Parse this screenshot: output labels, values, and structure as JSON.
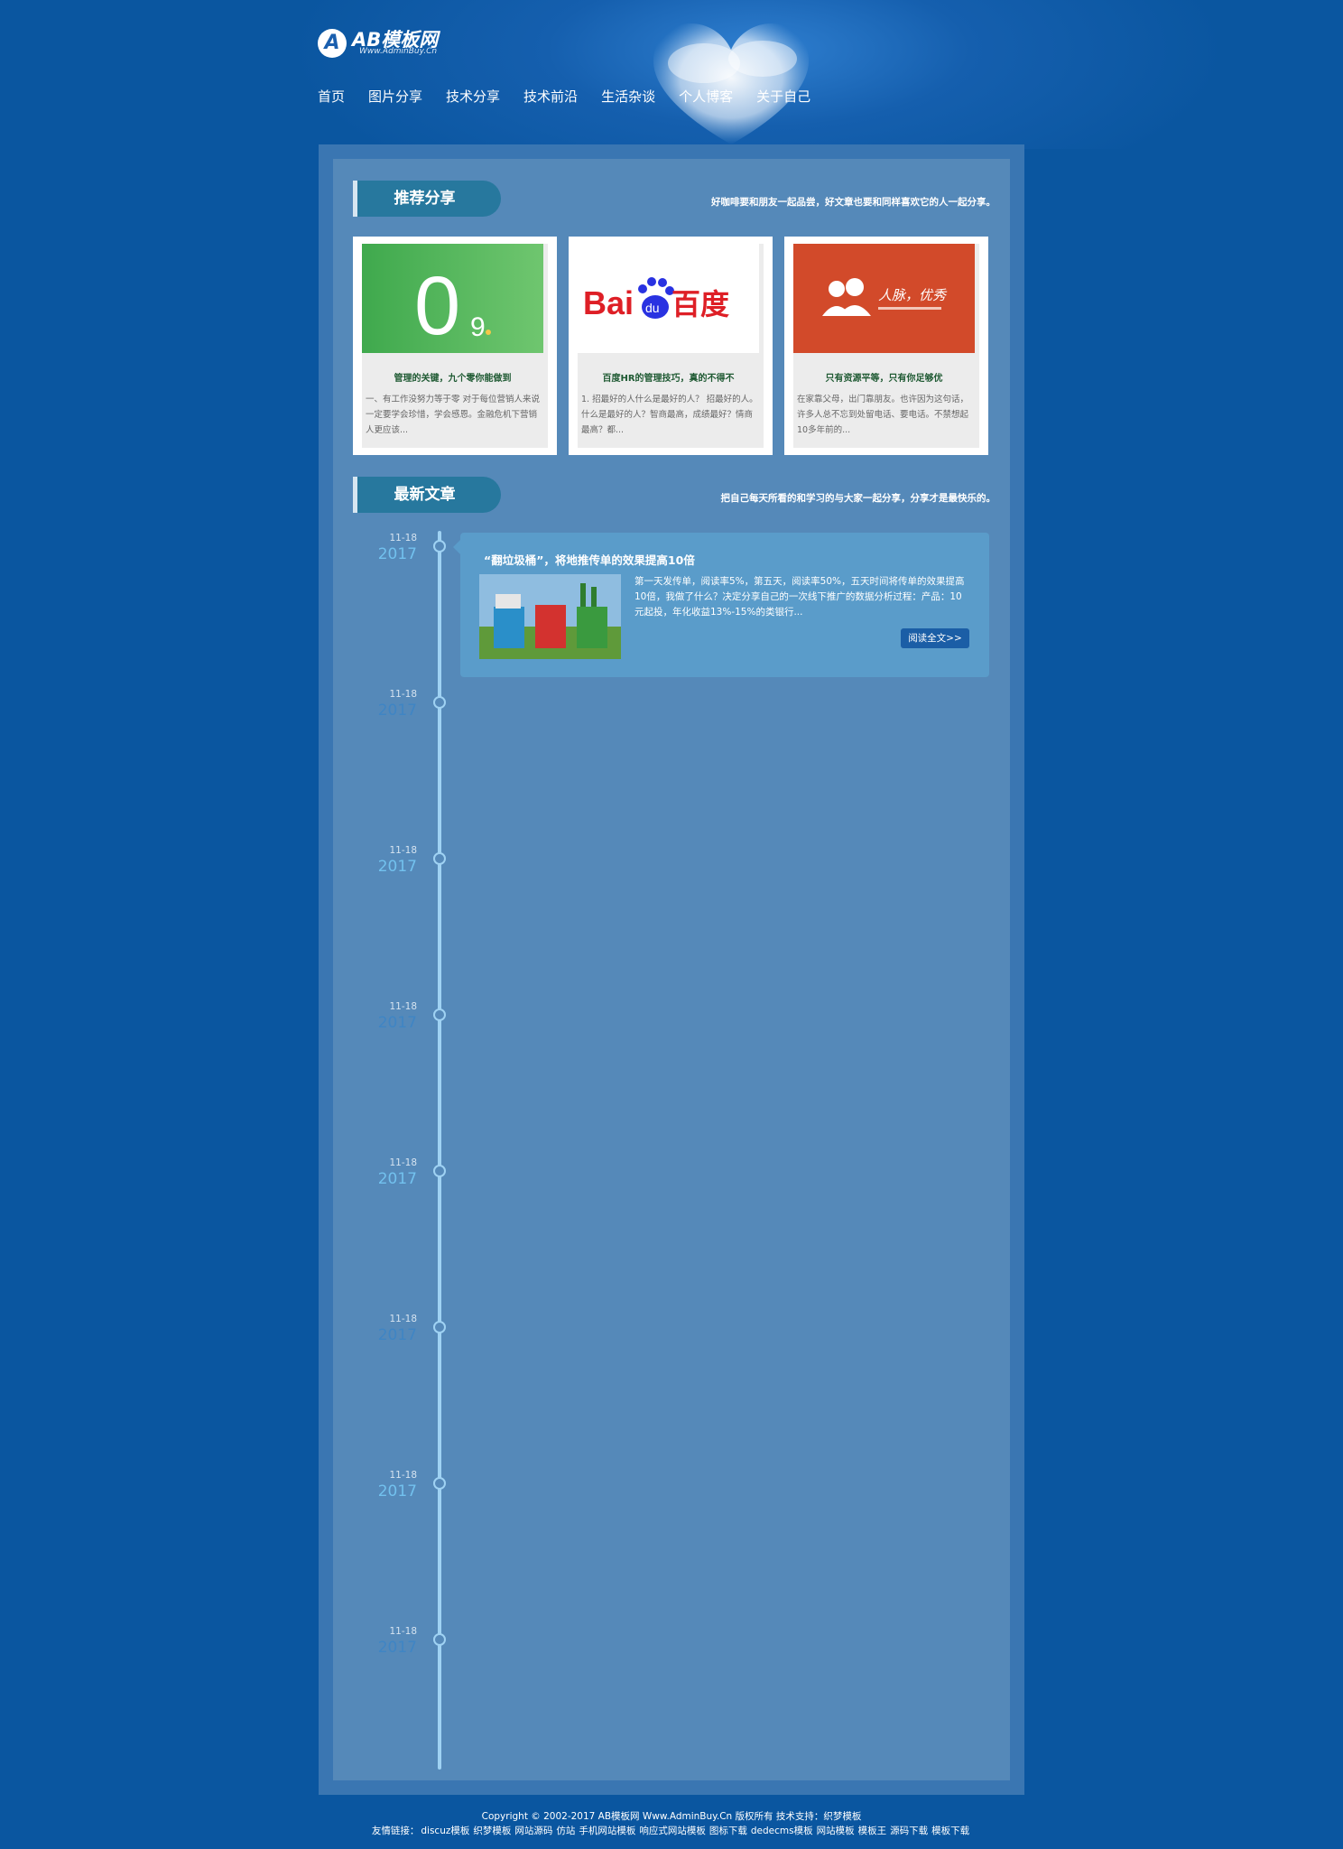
{
  "site": {
    "logo_text": "AB模板网",
    "logo_letter": "A",
    "logo_sub": "Www.AdminBuy.Cn"
  },
  "nav": [
    "首页",
    "图片分享",
    "技术分享",
    "技术前沿",
    "生活杂谈",
    "个人博客",
    "关于自己"
  ],
  "recommend": {
    "title": "推荐分享",
    "tagline": "好咖啡要和朋友一起品尝，好文章也要和同样喜欢它的人一起分享。",
    "cards": [
      {
        "title": "管理的关键，九个零你能做到",
        "desc": "一、有工作没努力等于零 对于每位营销人来说一定要学会珍惜，学会感恩。金融危机下营销人更应该...",
        "image_text": "0",
        "image_sub": "9",
        "image_color": "#4cb05a"
      },
      {
        "title": "百度HR的管理技巧，真的不得不",
        "desc": "1. 招最好的人什么是最好的人？ 招最好的人。什么是最好的人？智商最高，成绩最好？情商最高？都...",
        "image_text_left": "Bai",
        "image_text_mid": "du",
        "image_text_right": "百度",
        "image_color": "#ffffff"
      },
      {
        "title": "只有资源平等，只有你足够优",
        "desc": "在家靠父母，出门靠朋友。也许因为这句话，许多人总不忘到处留电话、要电话。不禁想起10多年前的...",
        "image_text": "人脉，优秀",
        "image_color": "#d24a2a"
      }
    ]
  },
  "latest": {
    "title": "最新文章",
    "tagline": "把自己每天所看的和学习的与大家一起分享，分享才是最快乐的。",
    "dates": [
      {
        "md": "11-18",
        "year": "2017"
      },
      {
        "md": "11-18",
        "year": "2017"
      },
      {
        "md": "11-18",
        "year": "2017"
      },
      {
        "md": "11-18",
        "year": "2017"
      },
      {
        "md": "11-18",
        "year": "2017"
      },
      {
        "md": "11-18",
        "year": "2017"
      },
      {
        "md": "11-18",
        "year": "2017"
      },
      {
        "md": "11-18",
        "year": "2017"
      }
    ],
    "post": {
      "title": "“翻垃圾桶”，将地推传单的效果提高10倍",
      "text": "第一天发传单，阅读率5%，第五天，阅读率50%，五天时间将传单的效果提高10倍，我做了什么？决定分享自己的一次线下推广的数据分析过程：产品：10元起投，年化收益13%-15%的类银行...",
      "button": "阅读全文>>"
    }
  },
  "footer": {
    "copyright": "Copyright © 2002-2017 AB模板网 Www.AdminBuy.Cn 版权所有 技术支持：织梦模板",
    "links_label": "友情链接：",
    "links": [
      "discuz模板",
      "织梦模板",
      "网站源码",
      "仿站",
      "手机网站模板",
      "响应式网站模板",
      "图标下载",
      "dedecms模板",
      "网站模板",
      "模板王",
      "源码下载",
      "模板下载"
    ]
  }
}
